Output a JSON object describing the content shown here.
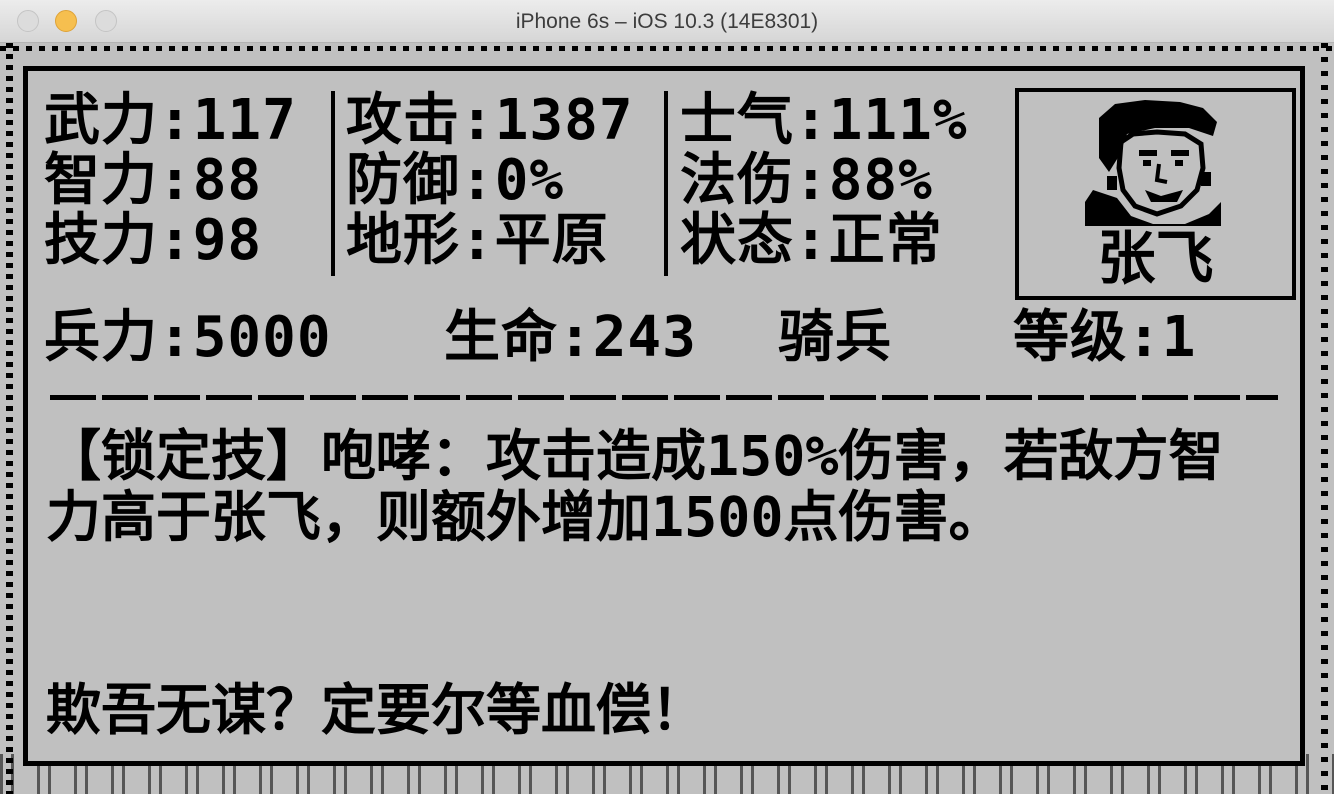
{
  "window": {
    "title": "iPhone 6s – iOS 10.3 (14E8301)"
  },
  "general": {
    "stats_col1": [
      {
        "label": "武力",
        "value": ":117"
      },
      {
        "label": "智力",
        "value": ":88"
      },
      {
        "label": "技力",
        "value": ":98"
      }
    ],
    "stats_col2": [
      {
        "label": "攻击",
        "value": ":1387"
      },
      {
        "label": "防御",
        "value": ":0%"
      },
      {
        "label": "地形",
        "value": ":平原"
      }
    ],
    "stats_col3": [
      {
        "label": "士气",
        "value": ":111%"
      },
      {
        "label": "法伤",
        "value": ":88%"
      },
      {
        "label": "状态",
        "value": ":正常"
      }
    ],
    "portrait_name": "张飞",
    "troops": {
      "label": "兵力",
      "value": ":5000"
    },
    "life": {
      "label": "生命",
      "value": ":243"
    },
    "unit_type": "骑兵",
    "level": {
      "label": "等级",
      "value": ":1"
    }
  },
  "skill_text": "【锁定技】咆哮：攻击造成150%伤害，若敌方智力高于张飞，则额外增加1500点伤害。",
  "quote_text": "欺吾无谋？定要尔等血偿！"
}
